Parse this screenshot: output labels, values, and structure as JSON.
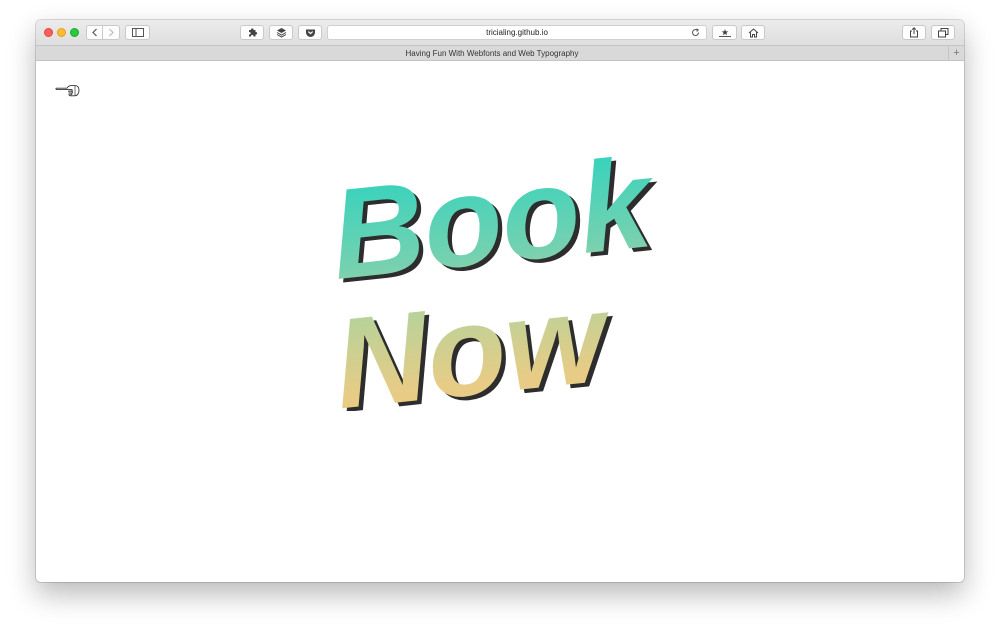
{
  "browser": {
    "url": "tricialing.github.io",
    "tab_title": "Having Fun With Webfonts and Web Typography",
    "new_tab_symbol": "+"
  },
  "icons": {
    "close": "close-button",
    "minimize": "minimize-button",
    "maximize": "maximize-button",
    "back": "chevron-left-icon",
    "forward": "chevron-right-icon",
    "sidebar": "sidebar-icon",
    "extension": "puzzle-icon",
    "layers": "layers-icon",
    "pocket": "pocket-icon",
    "reload": "reload-icon",
    "bookmark": "star-icon",
    "home": "home-icon",
    "share": "share-icon",
    "tabs": "tabs-icon",
    "pointer": "pointing-hand-icon"
  },
  "page": {
    "headline_word_1": "Book",
    "headline_word_2": "Now",
    "gradient_colors": [
      "#2cd3bf",
      "#76d1b0",
      "#b6d29a",
      "#e8cc86"
    ],
    "shadow_color": "#2d2d2d"
  }
}
